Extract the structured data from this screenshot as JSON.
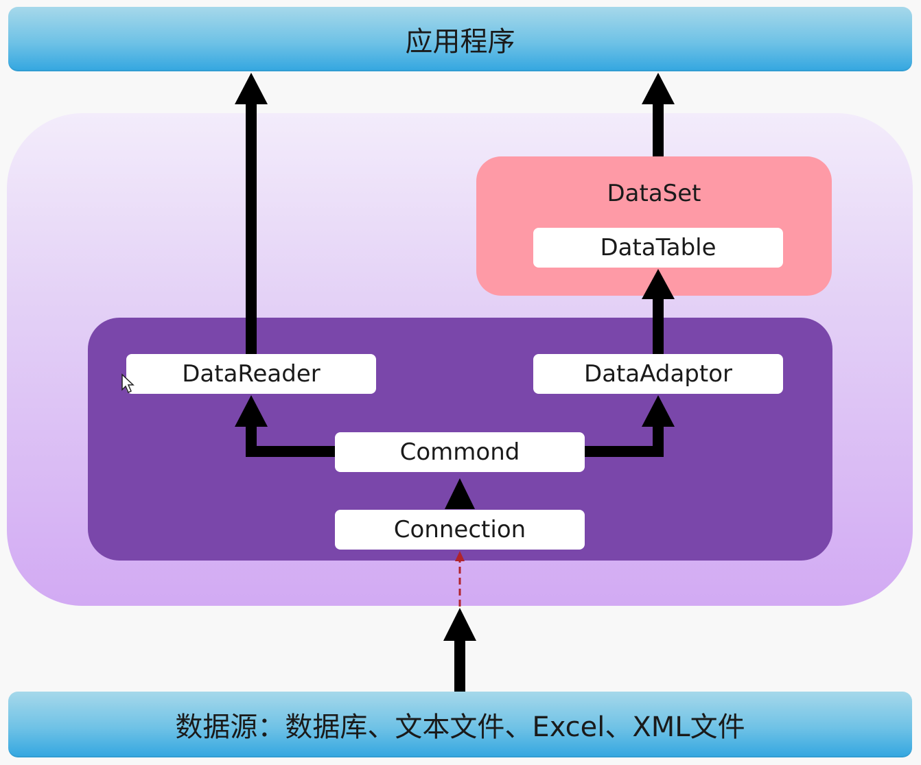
{
  "top_bar": {
    "label": "应用程序"
  },
  "bottom_bar": {
    "label": "数据源：数据库、文本文件、Excel、XML文件"
  },
  "dataset": {
    "label": "DataSet",
    "table_label": "DataTable"
  },
  "nodes": {
    "datareader": "DataReader",
    "dataadaptor": "DataAdaptor",
    "commond": "Commond",
    "connection": "Connection"
  },
  "colors": {
    "bar": "#6fc2e6",
    "outer_panel": "#d2aaf3",
    "inner_panel": "#7a47aa",
    "dataset_box": "#fe9aa6",
    "node": "#ffffff",
    "arrow": "#000000",
    "dashed_arrow": "#b0242b"
  }
}
